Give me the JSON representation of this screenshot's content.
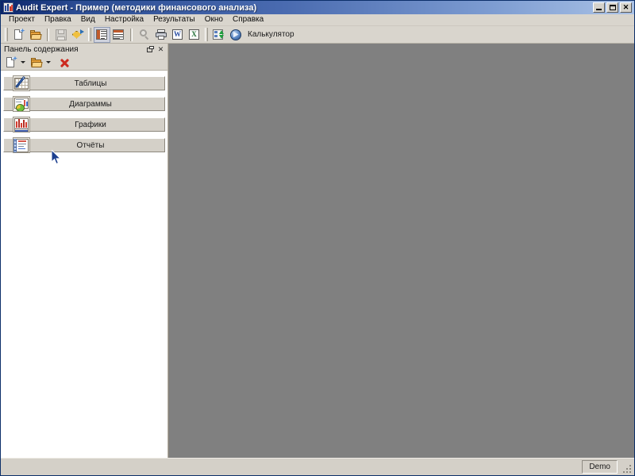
{
  "window": {
    "title": "Audit Expert - Пример (методики финансового анализа)",
    "app_icon": "audit-expert-icon",
    "buttons": {
      "minimize": "_",
      "maximize": "□",
      "close": "✕"
    }
  },
  "menu": {
    "items": [
      {
        "label": "Проект"
      },
      {
        "label": "Правка"
      },
      {
        "label": "Вид"
      },
      {
        "label": "Настройка"
      },
      {
        "label": "Результаты"
      },
      {
        "label": "Окно"
      },
      {
        "label": "Справка"
      }
    ]
  },
  "toolbar": {
    "groups": [
      {
        "buttons": [
          {
            "name": "new-document-button",
            "icon": "new-document-icon",
            "enabled": true
          },
          {
            "name": "open-project-button",
            "icon": "open-folder-icon",
            "enabled": true
          }
        ]
      },
      {
        "buttons": [
          {
            "name": "save-button",
            "icon": "save-disk-icon",
            "enabled": false
          },
          {
            "name": "export-button",
            "icon": "export-diamond-icon",
            "enabled": true
          }
        ]
      },
      {
        "buttons": [
          {
            "name": "content-panel-toggle-button",
            "icon": "list-view-icon",
            "enabled": true,
            "checked": true
          },
          {
            "name": "detail-panel-toggle-button",
            "icon": "wide-list-view-icon",
            "enabled": true,
            "checked": false
          }
        ]
      },
      {
        "buttons": [
          {
            "name": "preview-button",
            "icon": "magnifier-icon",
            "enabled": false
          },
          {
            "name": "print-button",
            "icon": "printer-icon",
            "enabled": true
          },
          {
            "name": "export-word-button",
            "icon": "word-icon",
            "glyph": "W",
            "enabled": true
          },
          {
            "name": "export-excel-button",
            "icon": "excel-icon",
            "glyph": "X",
            "enabled": true
          }
        ]
      },
      {
        "buttons": [
          {
            "name": "data-transfer-button",
            "icon": "transfer-arrows-icon",
            "enabled": true
          },
          {
            "name": "calculator-button",
            "icon": "calculator-disc-icon",
            "enabled": true
          }
        ]
      }
    ],
    "calculator_label": "Калькулятор"
  },
  "dock_panel": {
    "title": "Панель содержания",
    "pin_button": "pin-icon",
    "close_button": "✕",
    "toolbar": {
      "new_button": "new-item-icon",
      "new_dropdown": "chevron-down-icon",
      "open_button": "open-item-icon",
      "open_dropdown": "chevron-down-icon",
      "delete_button": "delete-red-x-icon"
    },
    "tree": {
      "nodes": [
        {
          "label": "Таблицы",
          "icon": "tables-icon",
          "expander": "+",
          "expanded": false
        },
        {
          "label": "Диаграммы",
          "icon": "charts-icon",
          "expander": "+",
          "expanded": false
        },
        {
          "label": "Графики",
          "icon": "graphs-icon",
          "expander": "+",
          "expanded": false
        },
        {
          "label": "Отчёты",
          "icon": "reports-icon",
          "expander": "+",
          "expanded": false
        }
      ]
    }
  },
  "mdi_client": {
    "background_color": "#808080",
    "open_documents": []
  },
  "status_bar": {
    "left_text": "",
    "license_panel": "Demo"
  },
  "colors": {
    "title_gradient_start": "#0a246a",
    "title_gradient_end": "#aac2e6",
    "face": "#d4d0c8",
    "mdi_background": "#808080",
    "accent_orange": "#c05a2c",
    "delete_red": "#cc2b20"
  }
}
